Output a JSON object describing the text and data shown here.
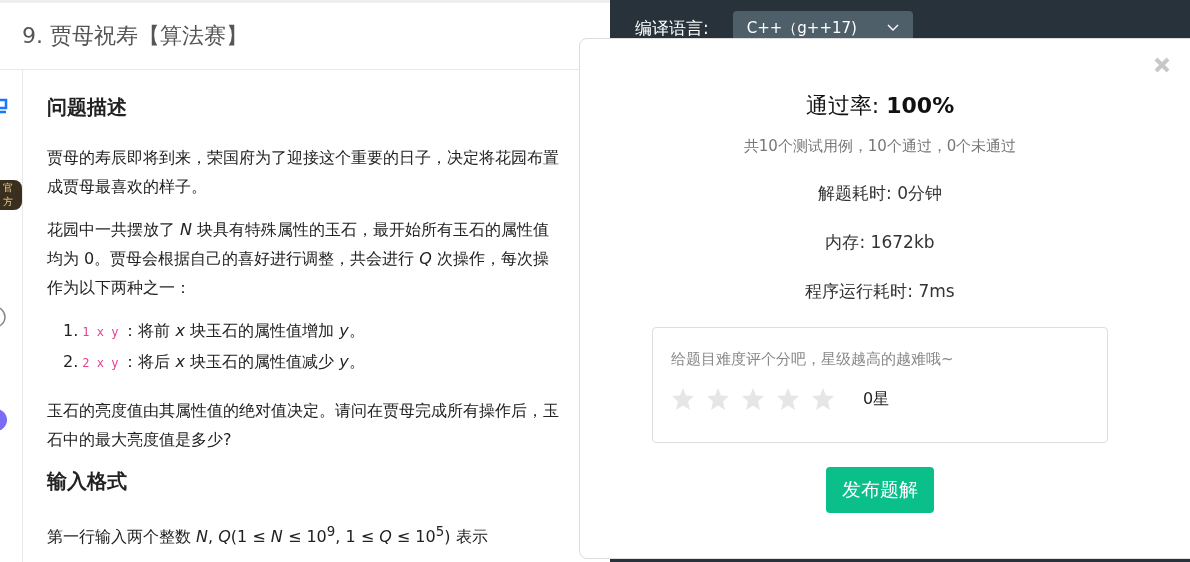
{
  "header": {
    "title": "9. 贾母祝寿【算法赛】"
  },
  "sidebar": {
    "badge": "官方"
  },
  "problem": [
    {
      "kind": "heading",
      "text": "问题描述"
    },
    {
      "kind": "paragraph",
      "text": "贾母的寿辰即将到来，荣国府为了迎接这个重要的日子，决定将花园布置成贾母最喜欢的样子。"
    },
    {
      "kind": "paragraph",
      "text": "花园中一共摆放了 *N* 块具有特殊属性的玉石，最开始所有玉石的属性值均为 0。贾母会根据自己的喜好进行调整，共会进行 *Q* 次操作，每次操作为以下两种之一："
    },
    {
      "kind": "list",
      "items": [
        {
          "marker": "1.",
          "code": "1 x y",
          "text": "：将前 *x* 块玉石的属性值增加 *y*。"
        },
        {
          "marker": "2.",
          "code": "2 x y",
          "text": "：将后 *x* 块玉石的属性值减少 *y*。"
        }
      ]
    },
    {
      "kind": "paragraph",
      "text": "玉石的亮度值由其属性值的绝对值决定。请问在贾母完成所有操作后，玉石中的最大亮度值是多少?"
    },
    {
      "kind": "heading",
      "text": "输入格式"
    },
    {
      "kind": "paragraph",
      "text": "第一行输入两个整数 *N*, *Q*(1 ≤ *N* ≤ 10$^{9}$, 1 ≤ *Q* ≤ 10$^{5}$) 表示"
    }
  ],
  "editor": {
    "language_label": "编译语言:",
    "language": "C++（g++17)"
  },
  "result": {
    "pass_rate": "通过率: **100%**",
    "summary": "共10个测试用例，10个通过，0个未通过",
    "stats": [
      "解题耗时: 0分钟",
      "内存: 1672kb",
      "程序运行耗时: 7ms"
    ],
    "rating": {
      "prompt": "给题目难度评个分吧，星级越高的越难哦~",
      "stars": 0,
      "reading": "0星"
    },
    "button": "发布题解"
  }
}
